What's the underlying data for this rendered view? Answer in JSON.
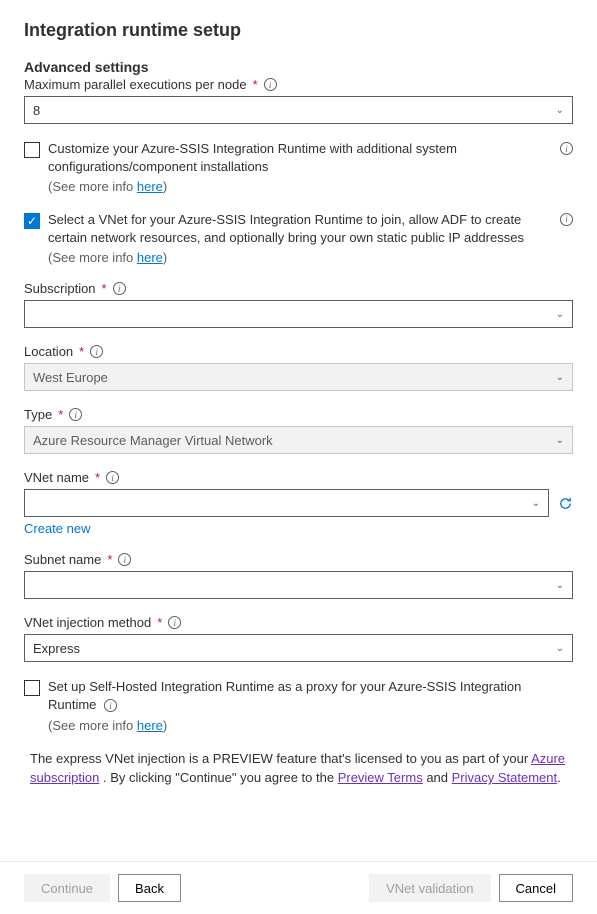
{
  "title": "Integration runtime setup",
  "advanced_heading": "Advanced settings",
  "max_parallel": {
    "label": "Maximum parallel executions per node",
    "value": "8"
  },
  "customize": {
    "text": "Customize your Azure-SSIS Integration Runtime with additional system configurations/component installations",
    "see_more_prefix": "(See more info ",
    "see_more_link": "here",
    "see_more_suffix": ")"
  },
  "vnet_select": {
    "text": "Select a VNet for your Azure-SSIS Integration Runtime to join, allow ADF to create certain network resources, and optionally bring your own static public IP addresses",
    "see_more_prefix": "(See more info ",
    "see_more_link": "here",
    "see_more_suffix": ")"
  },
  "subscription": {
    "label": "Subscription",
    "value": ""
  },
  "location": {
    "label": "Location",
    "value": "West Europe"
  },
  "type": {
    "label": "Type",
    "value": "Azure Resource Manager Virtual Network"
  },
  "vnet_name": {
    "label": "VNet name",
    "value": "",
    "create_new": "Create new"
  },
  "subnet_name": {
    "label": "Subnet name",
    "value": ""
  },
  "injection_method": {
    "label": "VNet injection method",
    "value": "Express"
  },
  "proxy": {
    "text": "Set up Self-Hosted Integration Runtime as a proxy for your Azure-SSIS Integration Runtime",
    "see_more_prefix": "(See more info ",
    "see_more_link": "here",
    "see_more_suffix": ")"
  },
  "preview": {
    "t1": "The express VNet injection is a PREVIEW feature that's licensed to you as part of your ",
    "link1": "Azure subscription",
    "t2": " . By clicking \"Continue\" you agree to the ",
    "link2": "Preview Terms",
    "t3": " and ",
    "link3": "Privacy Statement",
    "t4": "."
  },
  "footer": {
    "continue": "Continue",
    "back": "Back",
    "vnet_validation": "VNet validation",
    "cancel": "Cancel"
  }
}
